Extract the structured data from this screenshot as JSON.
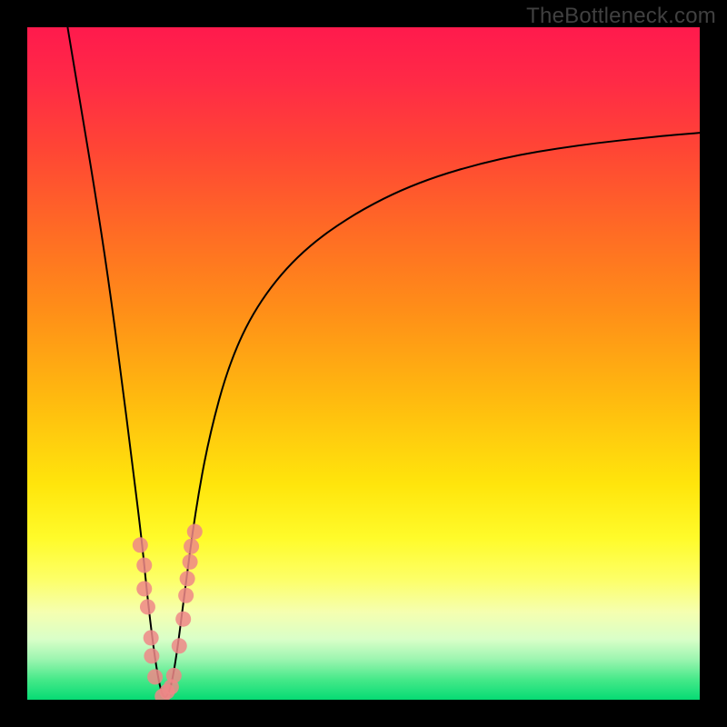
{
  "watermark": "TheBottleneck.com",
  "chart_data": {
    "type": "line",
    "title": "",
    "xlabel": "",
    "ylabel": "",
    "xlim": [
      0,
      100
    ],
    "ylim": [
      0,
      100
    ],
    "grid": false,
    "legend": false,
    "background": "vertical red-to-green heatmap gradient (high y = red/bad, low y = green/good)",
    "series": [
      {
        "name": "bottleneck-curve",
        "color": "#000000",
        "x": [
          6,
          8,
          10,
          12,
          14,
          15.5,
          17,
          18,
          19,
          19.8,
          20.4,
          21,
          21.6,
          22.4,
          23.4,
          25,
          27,
          30,
          34,
          40,
          48,
          58,
          70,
          82,
          94,
          100
        ],
        "y": [
          100,
          88,
          76,
          63,
          48,
          36,
          24,
          14,
          6,
          1.5,
          0.2,
          0.8,
          3,
          8,
          16,
          28,
          39,
          50,
          58.5,
          66,
          72,
          77,
          80.5,
          82.5,
          83.8,
          84.3
        ]
      }
    ],
    "markers": {
      "name": "reference-points",
      "color": "#ee8787",
      "radius_pct": 1.15,
      "x": [
        16.8,
        17.4,
        17.4,
        17.9,
        18.4,
        18.5,
        19.0,
        20.1,
        20.8,
        21.4,
        21.8,
        22.6,
        23.2,
        23.6,
        23.8,
        24.2,
        24.4,
        24.9
      ],
      "y": [
        23.0,
        20.0,
        16.5,
        13.8,
        9.2,
        6.5,
        3.4,
        0.5,
        1.2,
        1.9,
        3.6,
        8.0,
        12.0,
        15.5,
        18.0,
        20.5,
        22.8,
        25.0
      ]
    },
    "colors": {
      "curve": "#000000",
      "marker": "#ee8787",
      "frame": "#000000",
      "gradient_top": "#ff1a4d",
      "gradient_bottom": "#06db74"
    }
  }
}
